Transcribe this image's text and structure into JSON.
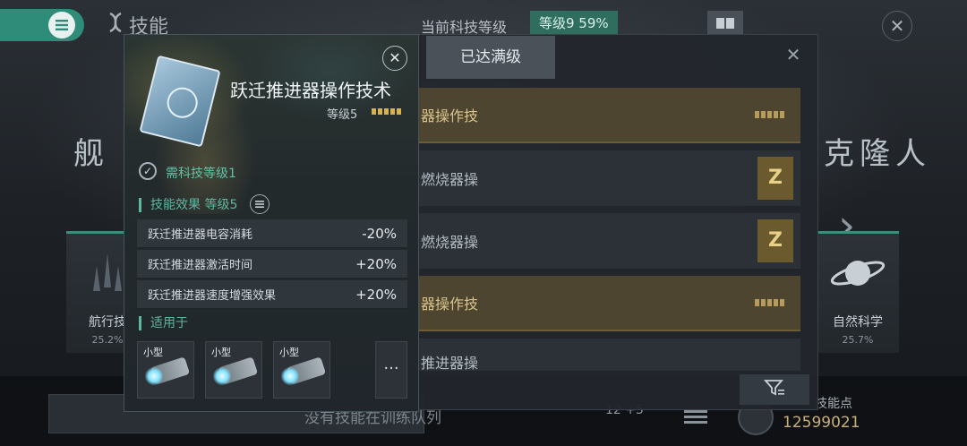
{
  "header": {
    "title": "技能",
    "tech_label": "当前科技等级",
    "tech_level": "等级9  59%"
  },
  "background": {
    "left_heading": "舰 船",
    "right_heading": "克隆人",
    "left_card": {
      "title": "航行技",
      "pct": "25.2%"
    },
    "right_card": {
      "title": "自然科学",
      "pct": "25.7%"
    }
  },
  "list_panel": {
    "maxed_tab": "已达满级",
    "rows": [
      {
        "text": "器操作技",
        "style": "gold"
      },
      {
        "text": "燃烧器操",
        "style": "dark"
      },
      {
        "text": "燃烧器操",
        "style": "dark"
      },
      {
        "text": "器操作技",
        "style": "gold"
      },
      {
        "text": "推进器操",
        "style": "dark"
      }
    ],
    "z_badge": "Z"
  },
  "popup": {
    "skill_name": "跃迁推进器操作技术",
    "skill_level": "等级5",
    "requirement": "需科技等级1",
    "effects_title": "技能效果 等级5",
    "effects": [
      {
        "label": "跃迁推进器电容消耗",
        "value": "-20%"
      },
      {
        "label": "跃迁推进器激活时间",
        "value": "+20%"
      },
      {
        "label": "跃迁推进器速度增强效果",
        "value": "+20%"
      }
    ],
    "applies_title": "适用于",
    "ships": [
      "小型",
      "小型",
      "小型"
    ],
    "more": "···"
  },
  "bottom": {
    "train_text": "没有技能在训练队列",
    "rank": "12 +5",
    "skill_points_label": "技能点",
    "skill_points_value": "12599021"
  }
}
